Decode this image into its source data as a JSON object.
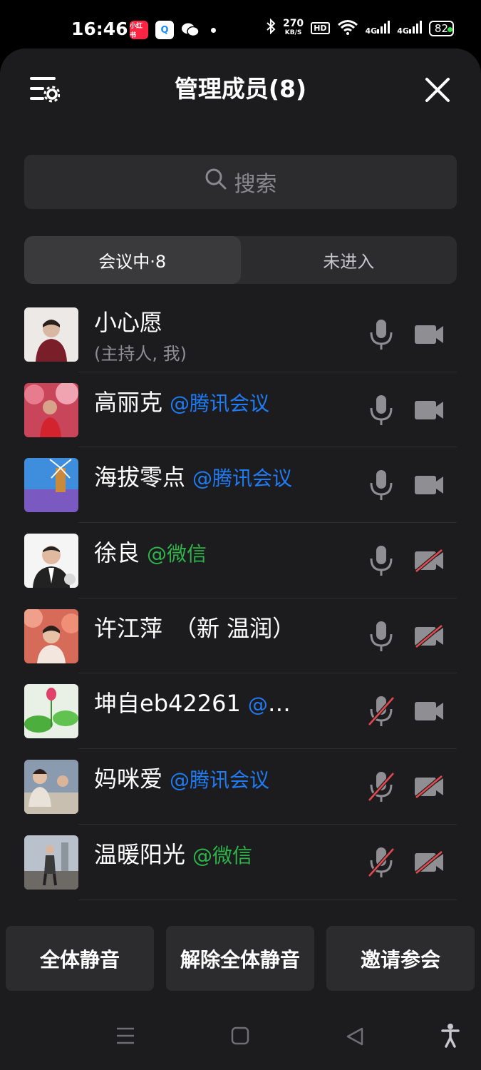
{
  "status_bar": {
    "time": "16:46",
    "app_icons": [
      "小红书",
      "Q",
      "wechat-icon"
    ],
    "net_speed_value": "270",
    "net_speed_unit": "KB/S",
    "hd_label": "HD",
    "signal_1": "4G",
    "signal_2": "4G",
    "battery": "82"
  },
  "header": {
    "title": "管理成员(8)"
  },
  "search": {
    "placeholder": "搜索"
  },
  "tabs": [
    {
      "label": "会议中·8",
      "active": true
    },
    {
      "label": "未进入",
      "active": false
    }
  ],
  "members": [
    {
      "name": "小心愿",
      "sub": "(主持人, 我)",
      "tag": "",
      "mic_on": true,
      "cam_on": true
    },
    {
      "name": "高丽克",
      "tag": "@腾讯会议",
      "tag_type": "tx",
      "mic_on": true,
      "cam_on": true
    },
    {
      "name": "海拔零点",
      "tag": "@腾讯会议",
      "tag_type": "tx",
      "mic_on": true,
      "cam_on": true
    },
    {
      "name": "徐良",
      "tag": "@微信",
      "tag_type": "wx",
      "mic_on": true,
      "cam_on": false
    },
    {
      "name": "许江萍　（新 温润）",
      "tag": "",
      "mic_on": true,
      "cam_on": false
    },
    {
      "name": "坤自eb42261",
      "tag": "@腾讯...",
      "tag_type": "tx",
      "mic_on": false,
      "cam_on": true
    },
    {
      "name": "妈咪爱",
      "tag": "@腾讯会议",
      "tag_type": "tx",
      "mic_on": false,
      "cam_on": false
    },
    {
      "name": "温暖阳光",
      "tag": "@微信",
      "tag_type": "wx",
      "mic_on": false,
      "cam_on": false
    }
  ],
  "actions": {
    "mute_all": "全体静音",
    "unmute_all": "解除全体静音",
    "invite": "邀请参会"
  },
  "colors": {
    "sheet_bg": "#1c1c1e",
    "tencent_tag": "#1f7cf5",
    "wechat_tag": "#2fb44a",
    "muted_slash": "#e5484d"
  }
}
